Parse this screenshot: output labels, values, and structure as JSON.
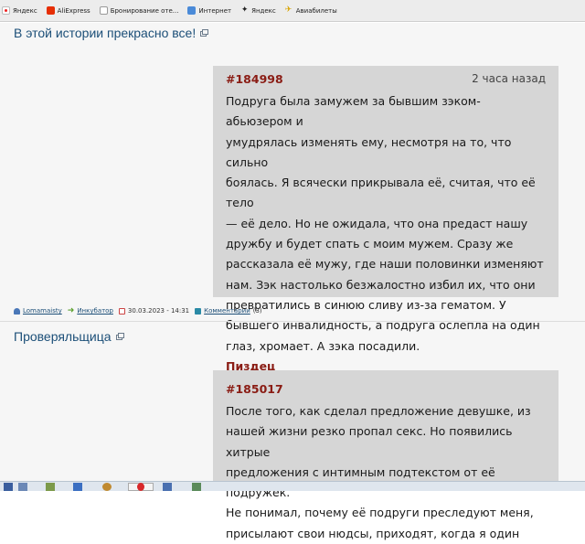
{
  "bookmarks": [
    {
      "label": "Яндекс",
      "icon": "yandex-icon"
    },
    {
      "label": "AliExpress",
      "icon": "aliexpress-icon"
    },
    {
      "label": "Бронирование оте...",
      "icon": "document-icon"
    },
    {
      "label": "Интернет",
      "icon": "globe-icon"
    },
    {
      "label": "Яндекс",
      "icon": "star-icon"
    },
    {
      "label": "Авиабилеты",
      "icon": "plane-icon"
    }
  ],
  "posts": [
    {
      "title": "В этой истории прекрасно все!",
      "id": "#184998",
      "time": "2 часа назад",
      "lines": [
        "Подруга была замужем за бывшим зэком-абьюзером и",
        "умудрялась изменять ему, несмотря на то, что сильно",
        "боялась. Я всячески прикрывала её, считая, что её тело",
        "— её дело. Но не ожидала, что она предаст нашу",
        "дружбу и будет спать с моим мужем. Сразу же",
        "рассказала её мужу, где наши половинки изменяют",
        "нам. Зэк настолько безжалостно избил их, что они",
        "превратились в синюю сливу из-за гематом. У",
        "бывшего инвалидность, а подруга ослепла на один",
        "глаз, хромает. А зэка посадили."
      ],
      "verdict": "Пиздец",
      "meta": {
        "author": "Lomamaisty",
        "category": "Инкубатор",
        "date": "30.03.2023 - 14:31",
        "comments_label": "Комментарии",
        "comments_count": "(3)"
      }
    },
    {
      "title": "Проверяльщица",
      "id": "#185017",
      "lines": [
        "После того, как сделал предложение девушке, из",
        "нашей жизни резко пропал секс. Но появились хитрые",
        "предложения с интимным подтекстом от её подружек.",
        "Не понимал, почему её подруги преследуют меня,",
        "присылают свои нюдсы, приходят, когда я один"
      ]
    }
  ],
  "colors": {
    "accent": "#1c4f78",
    "story_id": "#8a1c14",
    "story_bg": "#d6d6d6",
    "page_bg": "#f6f6f6"
  }
}
